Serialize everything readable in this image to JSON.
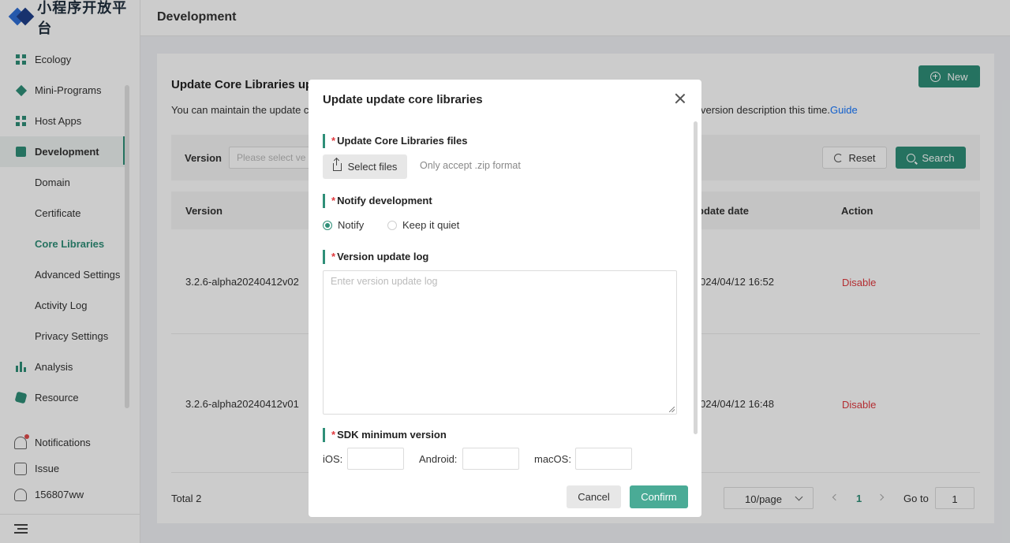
{
  "app": {
    "logo_text": "小程序开放平台"
  },
  "sidebar": {
    "items": [
      {
        "label": "Ecology",
        "icon": "grid-icon"
      },
      {
        "label": "Mini-Programs",
        "icon": "diamond-icon"
      },
      {
        "label": "Host Apps",
        "icon": "grid-icon"
      },
      {
        "label": "Development",
        "icon": "code-icon",
        "active": true
      }
    ],
    "sub_items": [
      "Domain",
      "Certificate",
      "Core Libraries",
      "Advanced Settings",
      "Activity Log",
      "Privacy Settings"
    ],
    "current_sub": "Core Libraries",
    "more_items": [
      {
        "label": "Analysis",
        "icon": "bar-chart-icon"
      },
      {
        "label": "Resource",
        "icon": "resource-icon"
      }
    ],
    "bottom": {
      "notifications": "Notifications",
      "issue": "Issue",
      "user": "156807ww"
    }
  },
  "header": {
    "title": "Development"
  },
  "page": {
    "title": "Update Core Libraries upd",
    "desc_left": "You can maintain the update c",
    "desc_right": "version description this time.",
    "guide_link": "Guide",
    "new_button": "New",
    "filter": {
      "label": "Version",
      "placeholder": "Please select ve"
    },
    "reset_button": "Reset",
    "search_button": "Search",
    "columns": {
      "version": "Version",
      "update_date": "pdate date",
      "action": "Action"
    },
    "rows": [
      {
        "version": "3.2.6-alpha20240412v02",
        "date": "024/04/12 16:52",
        "action": "Disable"
      },
      {
        "version": "3.2.6-alpha20240412v01",
        "date": "024/04/12 16:48",
        "action": "Disable"
      }
    ],
    "total": "Total 2",
    "page_size": "10/page",
    "current_page": "1",
    "goto_label": "Go to",
    "goto_value": "1"
  },
  "modal": {
    "title": "Update update core libraries",
    "files_section": "Update Core Libraries files",
    "select_files": "Select files",
    "files_hint": "Only accept .zip format",
    "notify_section": "Notify development",
    "notify_option": "Notify",
    "quiet_option": "Keep it quiet",
    "notify_selected": "Notify",
    "log_section": "Version update log",
    "log_placeholder": "Enter version update log",
    "sdk_section": "SDK minimum version",
    "sdk_ios": "iOS:",
    "sdk_android": "Android:",
    "sdk_macos": "macOS:",
    "cancel": "Cancel",
    "confirm": "Confirm"
  },
  "colors": {
    "accent": "#2f8f78",
    "danger": "#e0393e",
    "link": "#1677ff"
  }
}
